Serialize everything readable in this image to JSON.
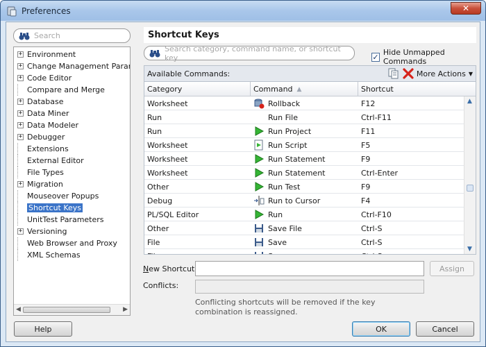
{
  "window": {
    "title": "Preferences",
    "close_label": "✕"
  },
  "left": {
    "search_placeholder": "Search",
    "tree": [
      {
        "label": "Environment",
        "expandable": true
      },
      {
        "label": "Change Management Paramet",
        "expandable": true
      },
      {
        "label": "Code Editor",
        "expandable": true
      },
      {
        "label": "Compare and Merge",
        "expandable": false
      },
      {
        "label": "Database",
        "expandable": true
      },
      {
        "label": "Data Miner",
        "expandable": true
      },
      {
        "label": "Data Modeler",
        "expandable": true
      },
      {
        "label": "Debugger",
        "expandable": true
      },
      {
        "label": "Extensions",
        "expandable": false
      },
      {
        "label": "External Editor",
        "expandable": false
      },
      {
        "label": "File Types",
        "expandable": false
      },
      {
        "label": "Migration",
        "expandable": true
      },
      {
        "label": "Mouseover Popups",
        "expandable": false
      },
      {
        "label": "Shortcut Keys",
        "expandable": false,
        "selected": true
      },
      {
        "label": "UnitTest Parameters",
        "expandable": false
      },
      {
        "label": "Versioning",
        "expandable": true
      },
      {
        "label": "Web Browser and Proxy",
        "expandable": false
      },
      {
        "label": "XML Schemas",
        "expandable": false
      }
    ]
  },
  "right": {
    "header": "Shortcut Keys",
    "search_placeholder": "Search category, command name, or shortcut key",
    "hide_unmapped": {
      "label": "Hide Unmapped Commands",
      "checked": true
    },
    "available_label": "Available Commands:",
    "more_actions": "More Actions",
    "table": {
      "columns": [
        "Category",
        "Command",
        "Shortcut"
      ],
      "rows": [
        {
          "category": "Worksheet",
          "command": "Rollback",
          "shortcut": "F12",
          "icon": "rollback-icon"
        },
        {
          "category": "Run",
          "command": "Run File",
          "shortcut": "Ctrl-F11",
          "icon": ""
        },
        {
          "category": "Run",
          "command": "Run Project",
          "shortcut": "F11",
          "icon": "run-icon"
        },
        {
          "category": "Worksheet",
          "command": "Run Script",
          "shortcut": "F5",
          "icon": "script-icon"
        },
        {
          "category": "Worksheet",
          "command": "Run Statement",
          "shortcut": "F9",
          "icon": "run-icon"
        },
        {
          "category": "Worksheet",
          "command": "Run Statement",
          "shortcut": "Ctrl-Enter",
          "icon": "run-icon"
        },
        {
          "category": "Other",
          "command": "Run Test",
          "shortcut": "F9",
          "icon": "run-icon"
        },
        {
          "category": "Debug",
          "command": "Run to Cursor",
          "shortcut": "F4",
          "icon": "cursor-icon"
        },
        {
          "category": "PL/SQL Editor",
          "command": "Run",
          "shortcut": "Ctrl-F10",
          "icon": "run-icon"
        },
        {
          "category": "Other",
          "command": "Save File",
          "shortcut": "Ctrl-S",
          "icon": "save-icon"
        },
        {
          "category": "File",
          "command": "Save",
          "shortcut": "Ctrl-S",
          "icon": "save-icon"
        },
        {
          "category": "File",
          "command": "Save",
          "shortcut": "Ctrl-S",
          "icon": "save-icon"
        }
      ]
    },
    "new_shortcut_label": "New Shortcut:",
    "new_shortcut_value": "",
    "assign_label": "Assign",
    "conflicts_label": "Conflicts:",
    "conflicts_value": "",
    "note": "Conflicting shortcuts will be removed if the key combination is reassigned."
  },
  "footer": {
    "help": "Help",
    "ok": "OK",
    "cancel": "Cancel"
  }
}
